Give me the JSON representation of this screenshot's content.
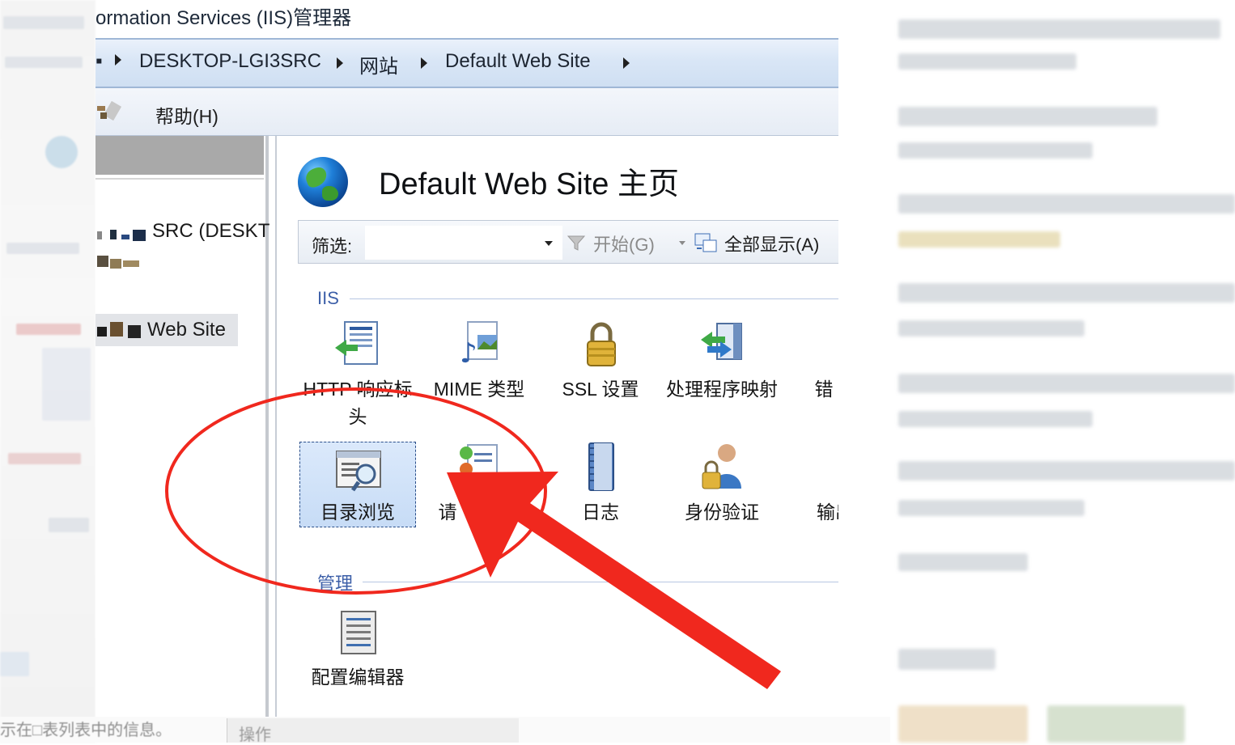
{
  "window": {
    "title": "ormation Services (IIS)管理器"
  },
  "breadcrumb": {
    "items": [
      "DESKTOP-LGI3SRC",
      "网站",
      "Default Web Site"
    ]
  },
  "menu": {
    "help_label": "帮助(H)"
  },
  "tree": {
    "server_label": "SRC (DESKT",
    "site_label": "Web Site"
  },
  "main": {
    "page_title": "Default Web Site 主页",
    "filter": {
      "label": "筛选:",
      "value": "",
      "start_label": "开始(G)",
      "show_all_label": "全部显示(A)"
    },
    "sections": [
      {
        "label": "IIS",
        "tiles": [
          {
            "label": "HTTP 响应标头",
            "icon": "http-response-headers-icon"
          },
          {
            "label": "MIME 类型",
            "icon": "mime-types-icon"
          },
          {
            "label": "SSL 设置",
            "icon": "ssl-lock-icon"
          },
          {
            "label": "处理程序映射",
            "icon": "handler-mappings-icon"
          },
          {
            "label": "错",
            "icon": "error-pages-icon"
          },
          {
            "label": "目录浏览",
            "icon": "directory-browsing-icon",
            "selected": true
          },
          {
            "label": "请",
            "icon": "request-filtering-icon"
          },
          {
            "label": "日志",
            "icon": "logging-icon"
          },
          {
            "label": "身份验证",
            "icon": "authentication-icon"
          },
          {
            "label": "输出",
            "icon": "output-caching-icon"
          }
        ]
      },
      {
        "label": "管理",
        "tiles": [
          {
            "label": "配置编辑器",
            "icon": "configuration-editor-icon"
          }
        ]
      }
    ]
  },
  "bottom": {
    "hint": "示在□表列表中的信息。",
    "actions_label": "操作"
  },
  "colors": {
    "annotation_red": "#f0281e",
    "section_blue": "#3c5fa8",
    "selection_fill": "#cfe0f7"
  }
}
